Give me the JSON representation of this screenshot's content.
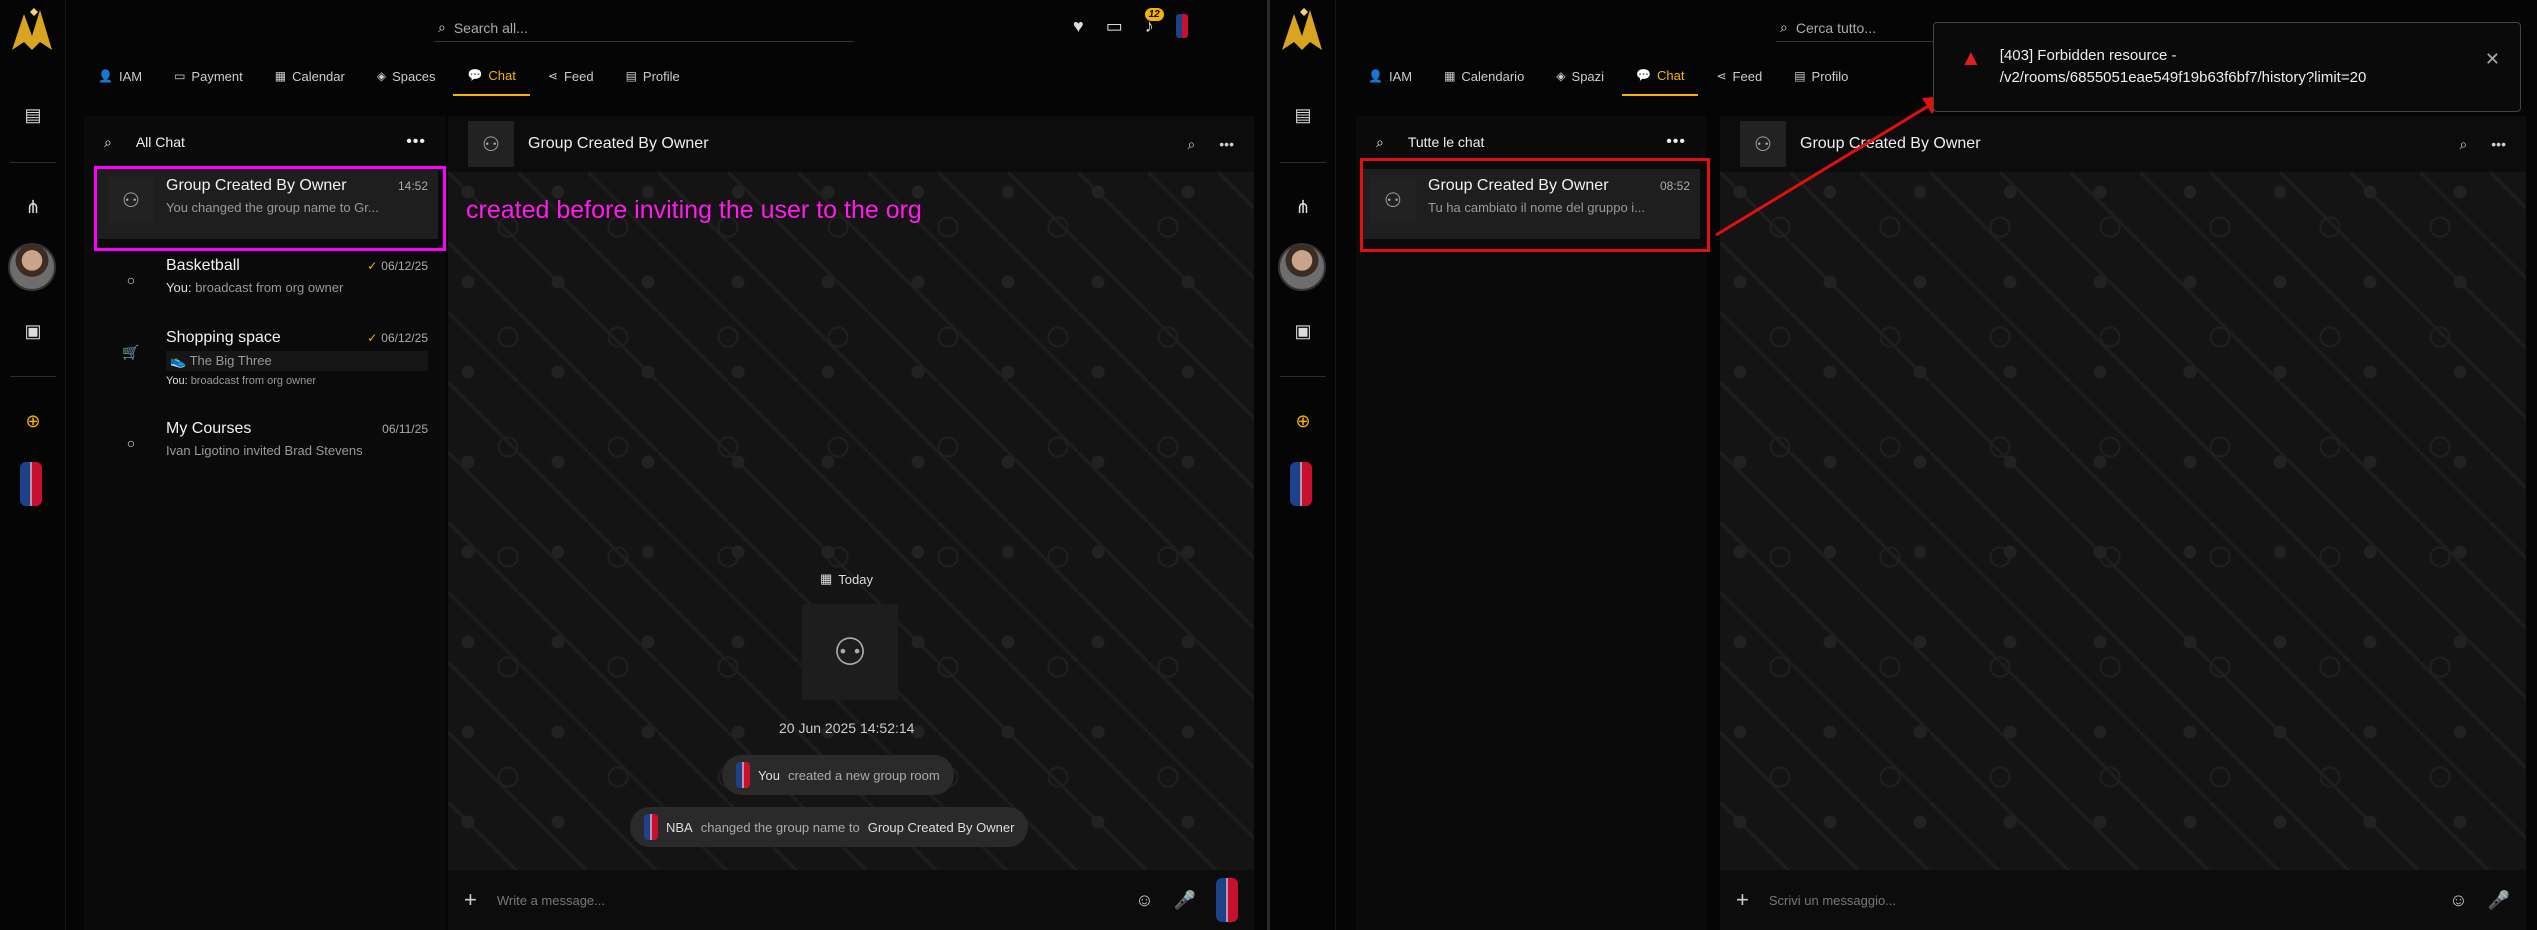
{
  "left": {
    "search_placeholder": "Search all...",
    "notification_count": "12",
    "tabs": [
      {
        "label": "IAM"
      },
      {
        "label": "Payment"
      },
      {
        "label": "Calendar"
      },
      {
        "label": "Spaces"
      },
      {
        "label": "Chat"
      },
      {
        "label": "Feed"
      },
      {
        "label": "Profile"
      }
    ],
    "chatlist": {
      "header": "All Chat",
      "items": [
        {
          "name": "Group Created By Owner",
          "time": "14:52",
          "preview": "You changed the group name to Gr..."
        },
        {
          "name": "Basketball",
          "time": "06/12/25",
          "sender": "You:",
          "preview": "broadcast from org owner"
        },
        {
          "name": "Shopping space",
          "time": "06/12/25",
          "tag": "The Big Three",
          "sender": "You:",
          "preview": "broadcast from org owner"
        },
        {
          "name": "My Courses",
          "time": "06/11/25",
          "preview": "Ivan Ligotino invited Brad Stevens"
        }
      ]
    },
    "conversation": {
      "title": "Group Created By Owner",
      "annotation": "created before inviting the user to the org",
      "day_label": "Today",
      "datetime": "20 Jun 2025 14:52:14",
      "events": [
        {
          "actor": "You",
          "text": "created a new group room",
          "target": ""
        },
        {
          "actor": "NBA",
          "text": "changed the group name to",
          "target": "Group Created By Owner"
        }
      ],
      "input_placeholder": "Write a message..."
    }
  },
  "right": {
    "search_placeholder": "Cerca tutto...",
    "tabs": [
      {
        "label": "IAM"
      },
      {
        "label": "Calendario"
      },
      {
        "label": "Spazi"
      },
      {
        "label": "Chat"
      },
      {
        "label": "Feed"
      },
      {
        "label": "Profilo"
      }
    ],
    "chatlist": {
      "header": "Tutte le chat",
      "items": [
        {
          "name": "Group Created By Owner",
          "time": "08:52",
          "preview": "Tu ha cambiato il nome del gruppo i..."
        }
      ]
    },
    "conversation": {
      "title": "Group Created By Owner",
      "input_placeholder": "Scrivi un messaggio..."
    },
    "toast": {
      "line1": "[403] Forbidden resource -",
      "line2": "/v2/rooms/6855051eae549f19b63f6bf7/history?limit=20"
    }
  },
  "colors": {
    "accent": "#f5b400",
    "annotation_magenta": "#ff00ff",
    "annotation_red": "#e01010",
    "error": "#e02020"
  }
}
